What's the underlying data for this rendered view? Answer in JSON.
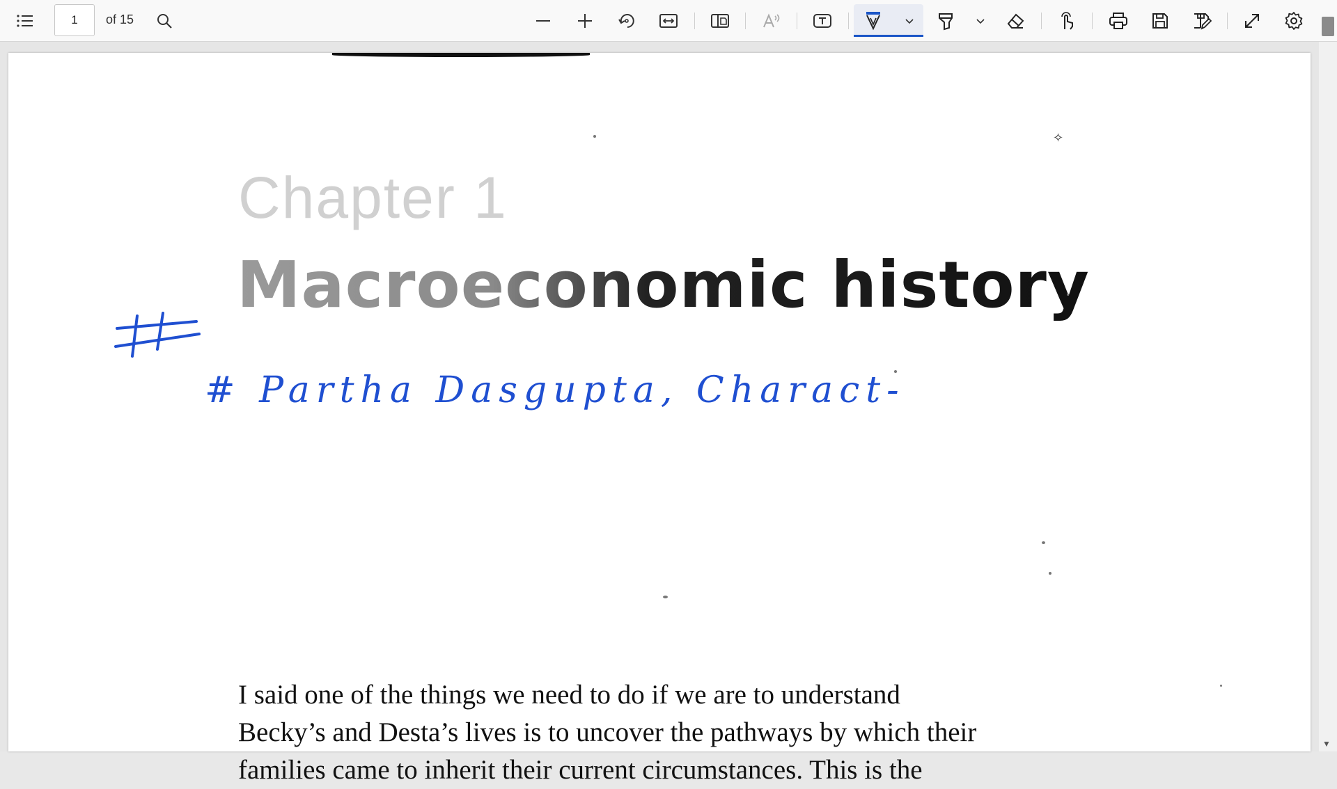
{
  "toolbar": {
    "page_number": "1",
    "page_count": "of 15",
    "icons": [
      "contents-list-icon",
      "search-icon",
      "zoom-out-icon",
      "zoom-in-icon",
      "rotate-icon",
      "fit-width-icon",
      "page-view-icon",
      "read-aloud-icon",
      "text-box-icon",
      "draw-icon",
      "draw-options-chevron-icon",
      "highlight-icon",
      "highlight-options-chevron-icon",
      "eraser-icon",
      "touch-write-icon",
      "print-icon",
      "save-icon",
      "save-as-icon",
      "full-screen-icon",
      "settings-icon"
    ]
  },
  "document": {
    "chapter_label": "Chapter 1",
    "title": "Macroeconomic history",
    "annotation_hash": "#",
    "annotation_text": "# Partha Dasgupta, Charact-",
    "body_lines": [
      "I said one of the things we need to do if we are to understand",
      "Becky’s and Desta’s lives is to uncover the pathways by which their",
      "families came to inherit their current circumstances. This is the"
    ]
  },
  "colors": {
    "ink": "#1f4fd1",
    "active_tool": "#1a55c7"
  }
}
